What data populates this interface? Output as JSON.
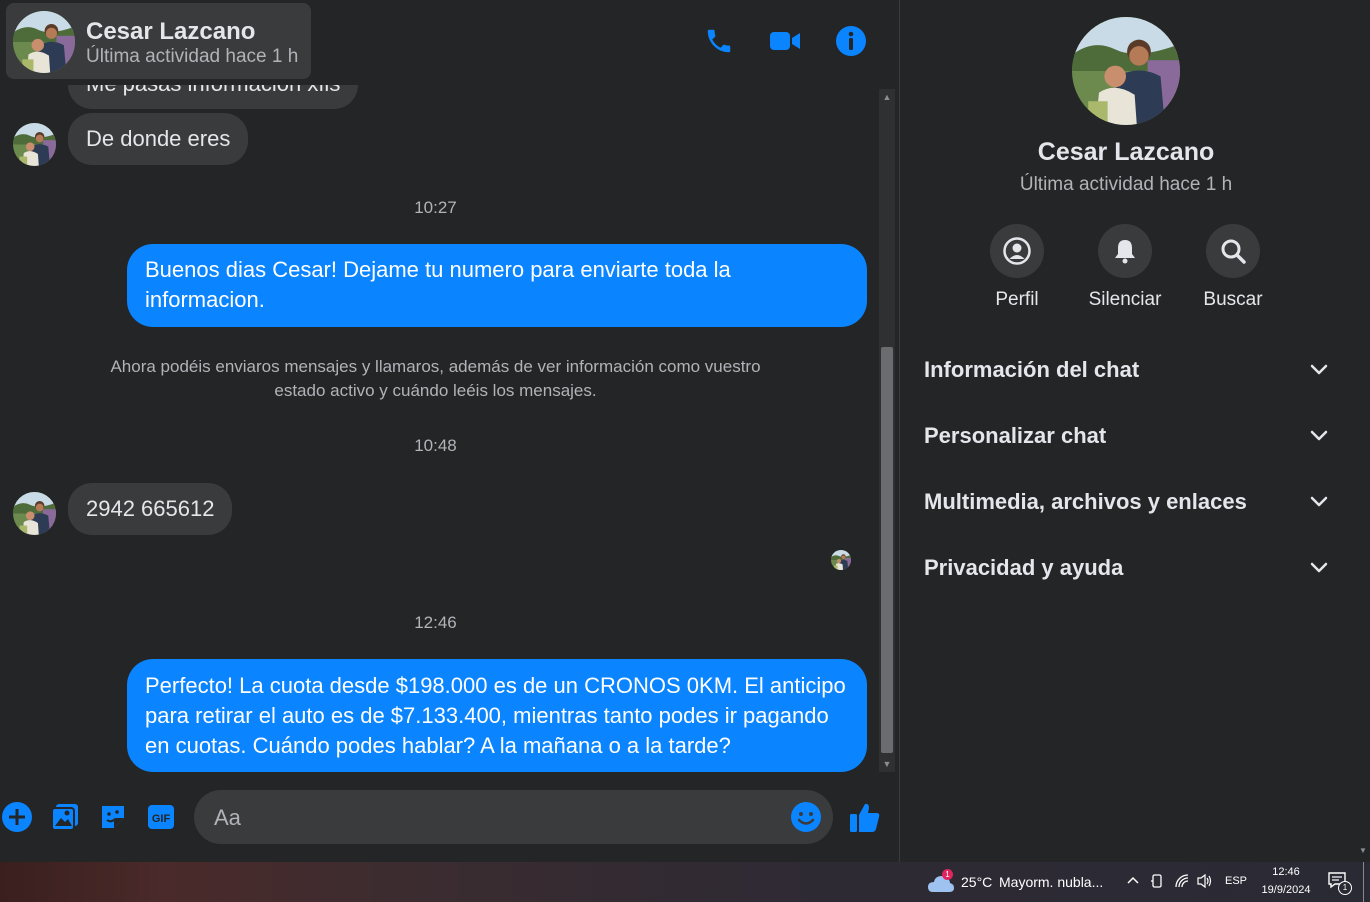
{
  "header": {
    "contact_name": "Cesar Lazcano",
    "status": "Última actividad hace 1 h"
  },
  "messages": {
    "partial_top_text": "Me pasas información xfis",
    "incoming_1": "De donde eres",
    "time_1": "10:27",
    "outgoing_1": "Buenos dias Cesar! Dejame tu numero para enviarte toda la informacion.",
    "system_note": "Ahora podéis enviaros mensajes y llamaros, además de ver información como vuestro estado activo y cuándo leéis los mensajes.",
    "time_2": "10:48",
    "incoming_2": "2942 665612",
    "time_3": "12:46",
    "outgoing_2": "Perfecto! La cuota desde $198.000 es de un CRONOS 0KM. El anticipo para retirar el auto es de $7.133.400, mientras tanto podes ir pagando en cuotas. Cuándo podes hablar? A la mañana o a la tarde?"
  },
  "composer": {
    "placeholder": "Aa"
  },
  "profile": {
    "name": "Cesar Lazcano",
    "status": "Última actividad hace 1 h",
    "actions": [
      {
        "label": "Perfil",
        "icon": "profile-icon"
      },
      {
        "label": "Silenciar",
        "icon": "bell-icon"
      },
      {
        "label": "Buscar",
        "icon": "search-icon"
      }
    ],
    "sections": [
      "Información del chat",
      "Personalizar chat",
      "Multimedia, archivos y enlaces",
      "Privacidad y ayuda"
    ]
  },
  "taskbar": {
    "weather_temp": "25°C",
    "weather_text": "Mayorm. nubla...",
    "weather_badge": "1",
    "language": "ESP",
    "time": "12:46",
    "date": "19/9/2024",
    "notification_count": "1"
  },
  "colors": {
    "accent": "#0a84ff",
    "background": "#242526",
    "bubble_incoming": "#3a3b3c"
  }
}
